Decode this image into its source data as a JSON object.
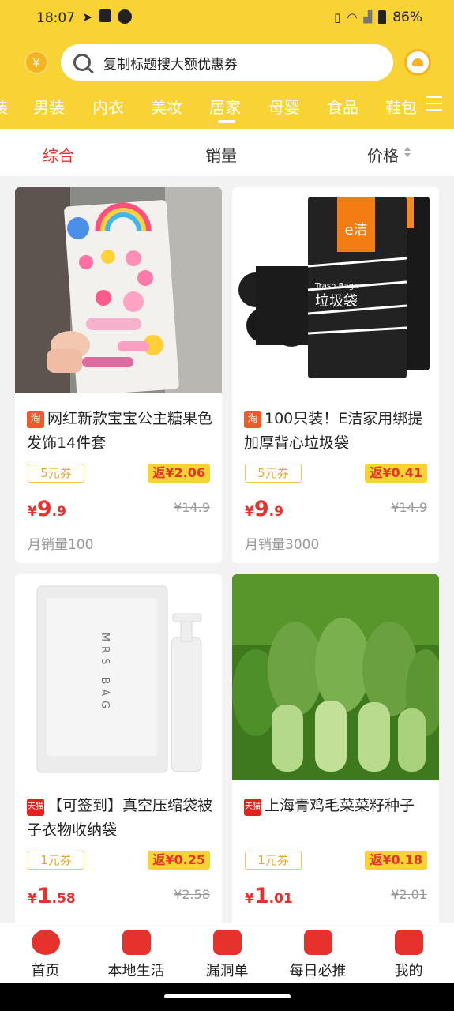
{
  "status": {
    "time": "18:07",
    "battery": "86%"
  },
  "search": {
    "placeholder": "复制标题搜大额优惠券"
  },
  "categories": [
    "装",
    "男装",
    "内衣",
    "美妆",
    "居家",
    "母婴",
    "食品",
    "鞋包"
  ],
  "active_category": "居家",
  "sort": {
    "comprehensive": "综合",
    "sales": "销量",
    "price": "价格"
  },
  "products": [
    {
      "platform": "淘",
      "title": "网红新款宝宝公主糖果色发饰14件套",
      "coupon": "5元券",
      "rebate": "返¥2.06",
      "price_yen": "¥",
      "price_int": "9",
      "price_dec": ".9",
      "original": "¥14.9",
      "sales": "月销量100"
    },
    {
      "platform": "淘",
      "title": "100只装！E洁家用绑提加厚背心垃圾袋",
      "coupon": "5元券",
      "rebate": "返¥0.41",
      "price_yen": "¥",
      "price_int": "9",
      "price_dec": ".9",
      "original": "¥14.9",
      "sales": "月销量3000"
    },
    {
      "platform": "天猫",
      "title": "【可签到】真空压缩袋被子衣物收纳袋",
      "coupon": "1元券",
      "rebate": "返¥0.25",
      "price_yen": "¥",
      "price_int": "1",
      "price_dec": ".58",
      "original": "¥2.58"
    },
    {
      "platform": "天猫",
      "title": "上海青鸡毛菜菜籽种子",
      "coupon": "1元券",
      "rebate": "返¥0.18",
      "price_yen": "¥",
      "price_int": "1",
      "price_dec": ".01",
      "original": "¥2.01"
    }
  ],
  "image_text": {
    "trash_brand": "e洁",
    "trash_en": "Trash Bags",
    "trash_cn": "垃圾袋",
    "bag_text": "MRS BAG"
  },
  "bottom_nav": [
    "首页",
    "本地生活",
    "漏洞单",
    "每日必推",
    "我的"
  ],
  "colors": {
    "brand_yellow": "#f9d233",
    "accent_red": "#e6312d"
  }
}
